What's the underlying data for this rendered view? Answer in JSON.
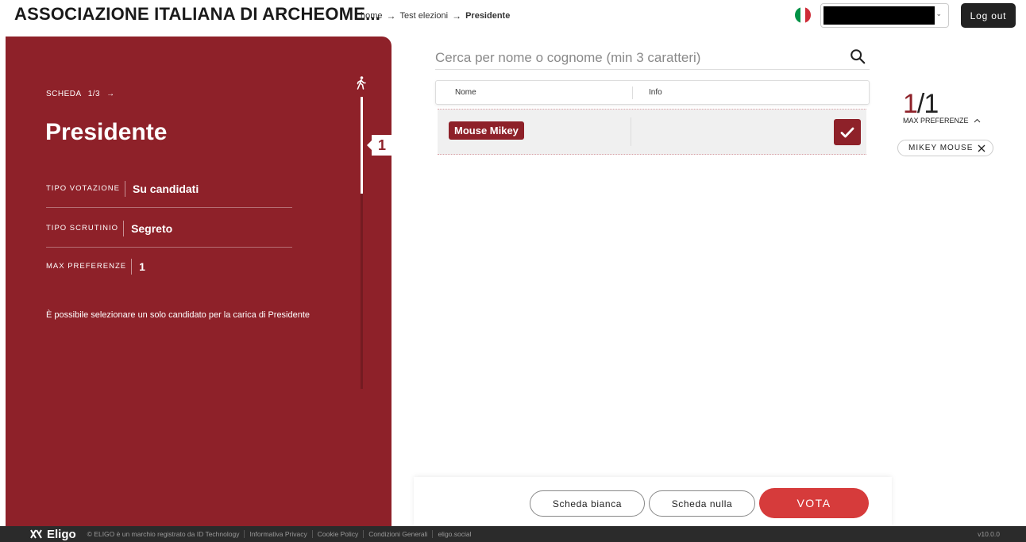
{
  "header": {
    "org_name": "ASSOCIAZIONE ITALIANA DI ARCHEOME...",
    "breadcrumb": [
      "home",
      "Test elezioni",
      "Presidente"
    ],
    "breadcrumb_arrow": "→",
    "logout_label": "Log out",
    "flag_colors": [
      "#009246",
      "#ffffff",
      "#ce2b37"
    ]
  },
  "ballot": {
    "scheda_label": "SCHEDA",
    "scheda_progress": "1/3",
    "title": "Presidente",
    "info": [
      {
        "key": "TIPO VOTAZIONE",
        "value": "Su candidati"
      },
      {
        "key": "TIPO SCRUTINIO",
        "value": "Segreto"
      },
      {
        "key": "MAX PREFERENZE",
        "value": "1"
      }
    ],
    "description": "È possibile selezionare un solo candidato per la carica di Presidente",
    "step_number": "1",
    "accent_color": "#8e2129"
  },
  "search": {
    "placeholder": "Cerca per nome o cognome (min 3 caratteri)"
  },
  "table": {
    "columns": [
      "Nome",
      "Info"
    ],
    "rows": [
      {
        "name": "Mouse Mikey",
        "info": "",
        "selected": true
      }
    ]
  },
  "selection": {
    "current": "1",
    "separator": "/",
    "max": "1",
    "max_label": "MAX PREFERENZE",
    "chips": [
      "MIKEY MOUSE"
    ]
  },
  "actions": {
    "blank_label": "Scheda bianca",
    "null_label": "Scheda nulla",
    "vote_label": "VOTA"
  },
  "footer": {
    "logo": "Eligo",
    "links": [
      "© ELIGO è un marchio registrato da ID Technology",
      "Informativa Privacy",
      "Cookie Policy",
      "Condizioni Generali",
      "eligo.social"
    ],
    "version": "v10.0.0"
  }
}
